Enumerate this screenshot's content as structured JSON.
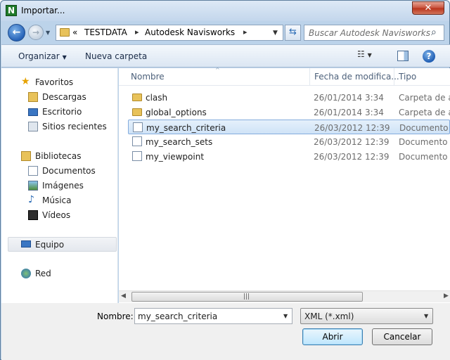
{
  "window": {
    "title": "Importar..."
  },
  "address": {
    "prefix": "«",
    "segments": [
      "TESTDATA",
      "Autodesk Navisworks"
    ]
  },
  "search": {
    "placeholder": "Buscar Autodesk Navisworks"
  },
  "toolbar": {
    "organize": "Organizar",
    "new_folder": "Nueva carpeta"
  },
  "nav": {
    "favorites": {
      "label": "Favoritos",
      "items": [
        "Descargas",
        "Escritorio",
        "Sitios recientes"
      ]
    },
    "libraries": {
      "label": "Bibliotecas",
      "items": [
        "Documentos",
        "Imágenes",
        "Música",
        "Vídeos"
      ]
    },
    "computer": "Equipo",
    "network": "Red"
  },
  "columns": {
    "name": "Nombre",
    "date": "Fecha de modifica...",
    "type": "Tipo"
  },
  "files": [
    {
      "name": "clash",
      "date": "26/01/2014 3:34",
      "type": "Carpeta de a",
      "kind": "folder"
    },
    {
      "name": "global_options",
      "date": "26/01/2014 3:34",
      "type": "Carpeta de a",
      "kind": "folder"
    },
    {
      "name": "my_search_criteria",
      "date": "26/03/2012 12:39",
      "type": "Documento",
      "kind": "xml",
      "selected": true
    },
    {
      "name": "my_search_sets",
      "date": "26/03/2012 12:39",
      "type": "Documento",
      "kind": "xml"
    },
    {
      "name": "my_viewpoint",
      "date": "26/03/2012 12:39",
      "type": "Documento",
      "kind": "xml"
    }
  ],
  "footer": {
    "name_label": "Nombre:",
    "name_value": "my_search_criteria",
    "file_type": "XML (*.xml)",
    "open": "Abrir",
    "cancel": "Cancelar"
  }
}
